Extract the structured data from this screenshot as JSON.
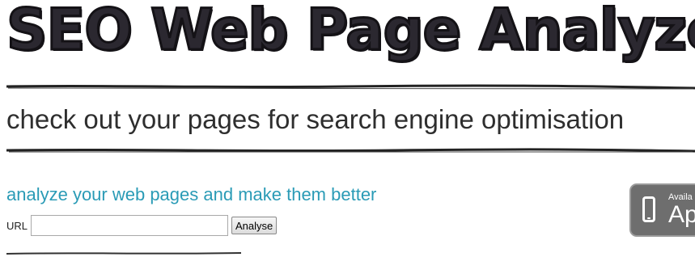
{
  "header": {
    "logo_title": "SEO Web Page Analyzer",
    "tagline": "check out your pages for search engine optimisation"
  },
  "main": {
    "section_heading": "analyze your web pages and make them better",
    "form": {
      "url_label": "URL",
      "url_value": "",
      "url_placeholder": "",
      "submit_label": "Analyse"
    }
  },
  "appstore_badge": {
    "small_text": "Availa",
    "large_text": "Ap",
    "icon": "phone-icon"
  },
  "colors": {
    "heading_accent": "#2a9bb6",
    "title_ink": "#2b2830",
    "badge_bg": "#6e6e6e"
  }
}
